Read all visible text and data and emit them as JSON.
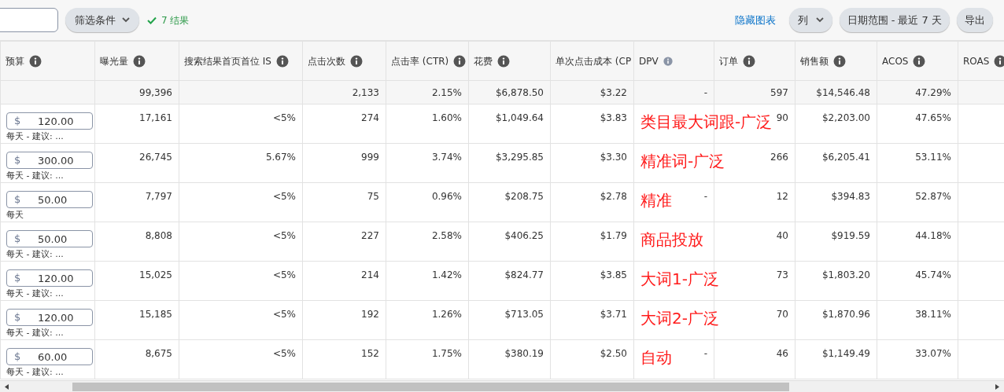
{
  "toolbar": {
    "filter_button": "筛选条件",
    "result_count": "7 结果",
    "hide_chart_link": "隐藏图表",
    "columns_button": "列",
    "date_range_button": "日期范围 - 最近 7 天",
    "export_button": "导出"
  },
  "table": {
    "columns": [
      {
        "label": "预算",
        "info_icon": true,
        "icon_muted": false
      },
      {
        "label": "曝光量",
        "info_icon": true,
        "icon_muted": false
      },
      {
        "label": "搜索结果首页首位 IS",
        "info_icon": true,
        "icon_muted": false
      },
      {
        "label": "点击次数",
        "info_icon": true,
        "icon_muted": false
      },
      {
        "label": "点击率 (CTR)",
        "info_icon": true,
        "icon_muted": false
      },
      {
        "label": "花费",
        "info_icon": true,
        "icon_muted": false
      },
      {
        "label": "单次点击成本 (CP",
        "info_icon": false
      },
      {
        "label": "DPV",
        "info_icon": true,
        "icon_muted": true
      },
      {
        "label": "订单",
        "info_icon": true,
        "icon_muted": false
      },
      {
        "label": "销售额",
        "info_icon": true,
        "icon_muted": false
      },
      {
        "label": "ACOS",
        "info_icon": true,
        "icon_muted": false
      },
      {
        "label": "ROAS",
        "info_icon": true,
        "icon_muted": false
      }
    ],
    "totals": {
      "impressions": "99,396",
      "clicks": "2,133",
      "ctr": "2.15%",
      "spend": "$6,878.50",
      "cpc": "$3.22",
      "dpv": "-",
      "orders": "597",
      "sales": "$14,546.48",
      "acos": "47.29%"
    },
    "rows": [
      {
        "currency": "$",
        "budget_note": "每天 - 建议: ...",
        "cells": [
          "120.00",
          "17,161",
          "<5%",
          "274",
          "1.60%",
          "$1,049.64",
          "$3.83",
          "",
          "90",
          "$2,203.00",
          "47.65%",
          ""
        ],
        "annotation": "类目最大词跟-广泛"
      },
      {
        "currency": "$",
        "budget_note": "每天 - 建议: ...",
        "cells": [
          "300.00",
          "26,745",
          "5.67%",
          "999",
          "3.74%",
          "$3,295.85",
          "$3.30",
          "",
          "266",
          "$6,205.41",
          "53.11%",
          ""
        ],
        "annotation": "精准词-广泛"
      },
      {
        "currency": "$",
        "budget_note": "每天",
        "cells": [
          "50.00",
          "7,797",
          "<5%",
          "75",
          "0.96%",
          "$208.75",
          "$2.78",
          "-",
          "12",
          "$394.83",
          "52.87%",
          ""
        ],
        "annotation": "精准"
      },
      {
        "currency": "$",
        "budget_note": "每天 - 建议: ...",
        "cells": [
          "50.00",
          "8,808",
          "<5%",
          "227",
          "2.58%",
          "$406.25",
          "$1.79",
          "",
          "40",
          "$919.59",
          "44.18%",
          ""
        ],
        "annotation": "商品投放"
      },
      {
        "currency": "$",
        "budget_note": "每天 - 建议: ...",
        "cells": [
          "120.00",
          "15,025",
          "<5%",
          "214",
          "1.42%",
          "$824.77",
          "$3.85",
          "",
          "73",
          "$1,803.20",
          "45.74%",
          ""
        ],
        "annotation": "大词1-广泛"
      },
      {
        "currency": "$",
        "budget_note": "每天 - 建议: ...",
        "cells": [
          "120.00",
          "15,185",
          "<5%",
          "192",
          "1.26%",
          "$713.05",
          "$3.71",
          "",
          "70",
          "$1,870.96",
          "38.11%",
          ""
        ],
        "annotation": "大词2-广泛"
      },
      {
        "currency": "$",
        "budget_note": "每天 - 建议: ...",
        "cells": [
          "60.00",
          "8,675",
          "<5%",
          "152",
          "1.75%",
          "$380.19",
          "$2.50",
          "-",
          "46",
          "$1,149.49",
          "33.07%",
          ""
        ],
        "annotation": "自动"
      }
    ]
  }
}
